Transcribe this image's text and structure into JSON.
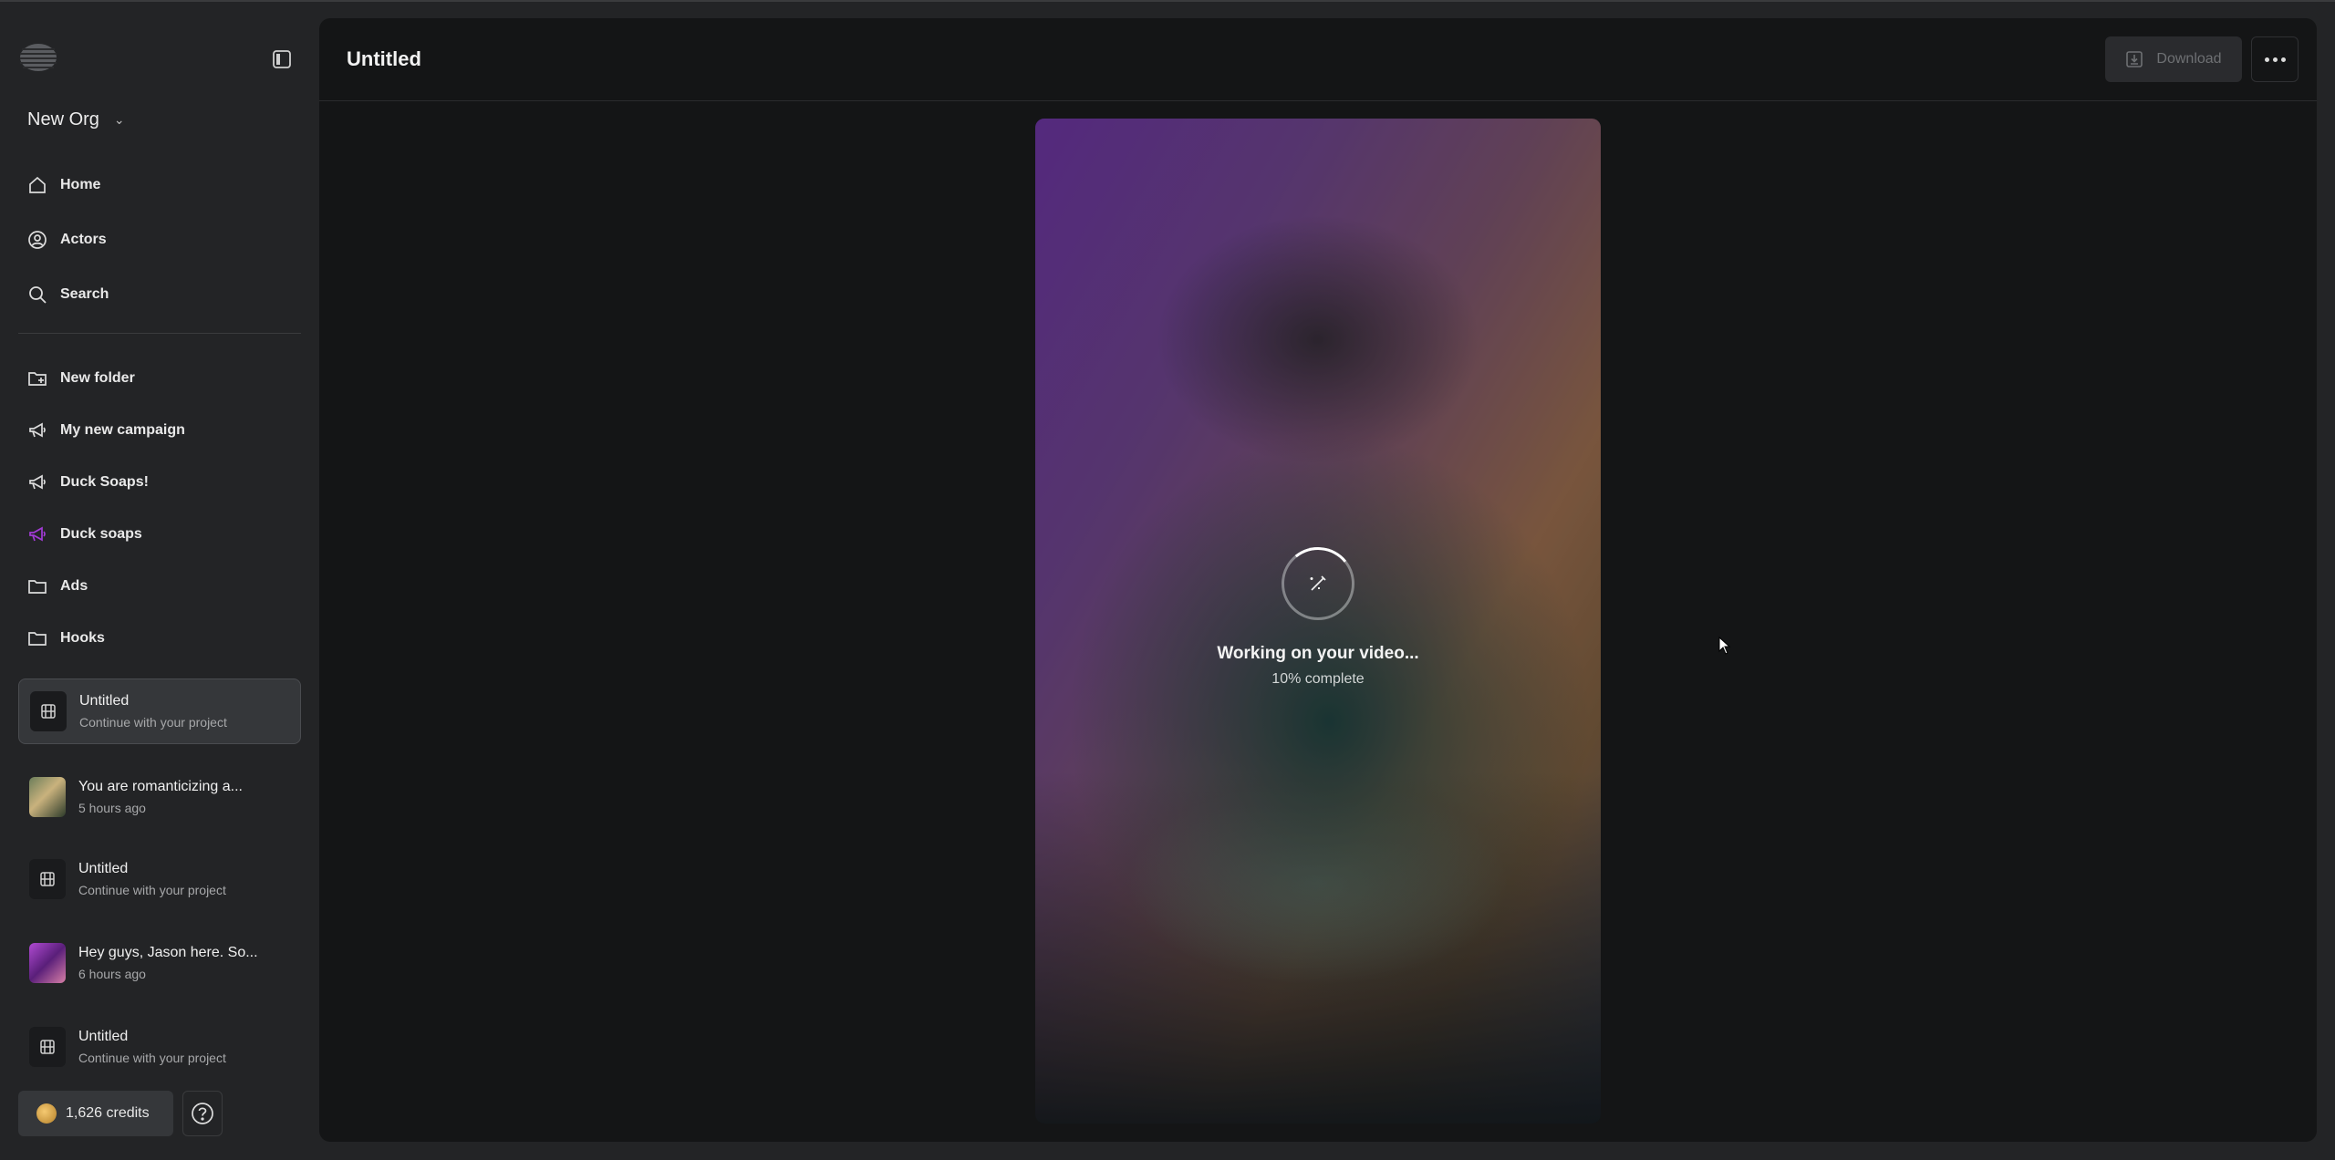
{
  "sidebar": {
    "org_name": "New Org",
    "nav": [
      {
        "label": "Home",
        "icon": "home-icon"
      },
      {
        "label": "Actors",
        "icon": "user-circle-icon"
      },
      {
        "label": "Search",
        "icon": "search-icon"
      }
    ],
    "folders": [
      {
        "label": "New folder",
        "icon": "folder-plus-icon"
      },
      {
        "label": "My new campaign",
        "icon": "megaphone-icon"
      },
      {
        "label": "Duck Soaps!",
        "icon": "megaphone-icon"
      },
      {
        "label": "Duck soaps",
        "icon": "megaphone-icon",
        "color": "#a23bd6"
      },
      {
        "label": "Ads",
        "icon": "folder-icon"
      },
      {
        "label": "Hooks",
        "icon": "folder-icon"
      }
    ],
    "projects": [
      {
        "title": "Untitled",
        "subtitle": "Continue with your project",
        "active": true
      },
      {
        "title": "You are romanticizing a...",
        "subtitle": "5 hours ago"
      },
      {
        "title": "Untitled",
        "subtitle": "Continue with your project"
      },
      {
        "title": "Hey guys, Jason here. So...",
        "subtitle": "6 hours ago"
      },
      {
        "title": "Untitled",
        "subtitle": "Continue with your project"
      }
    ],
    "credits": "1,626 credits"
  },
  "header": {
    "title": "Untitled",
    "download_label": "Download"
  },
  "video": {
    "status": "Working on your video...",
    "progress_text": "10% complete",
    "progress_fraction": 0.1
  }
}
